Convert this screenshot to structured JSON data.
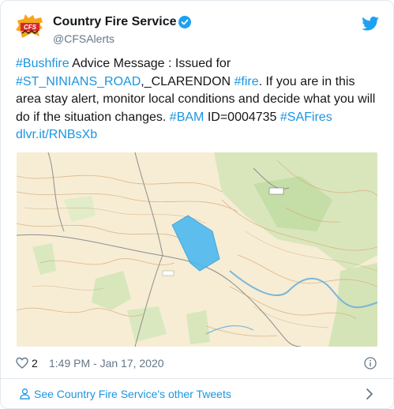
{
  "account": {
    "display_name": "Country Fire Service",
    "handle": "@CFSAlerts",
    "avatar_text": "CFS",
    "verified_icon": "verified-badge-icon",
    "platform_icon": "twitter-bird-icon"
  },
  "tweet": {
    "hashtag_bushfire": "#Bushfire",
    "text_1": " Advice Message : Issued for ",
    "hashtag_road": "#ST_NINIANS_ROAD",
    "text_2": ",_CLARENDON ",
    "hashtag_fire": "#fire",
    "text_3": ". If you are in this area stay alert, monitor local conditions and decide what you will do if the situation changes. ",
    "hashtag_bam": "#BAM",
    "text_4": " ID=0004735 ",
    "hashtag_safires": "#SAFires",
    "link": "dlvr.it/RNBsXb"
  },
  "meta": {
    "likes": "2",
    "timestamp": "1:49 PM - Jan 17, 2020"
  },
  "footer": {
    "label": "See Country Fire Service's other Tweets"
  },
  "colors": {
    "link": "#1b95e0",
    "text": "#14171a",
    "muted": "#657786",
    "fire_area": "#4db8f0"
  }
}
